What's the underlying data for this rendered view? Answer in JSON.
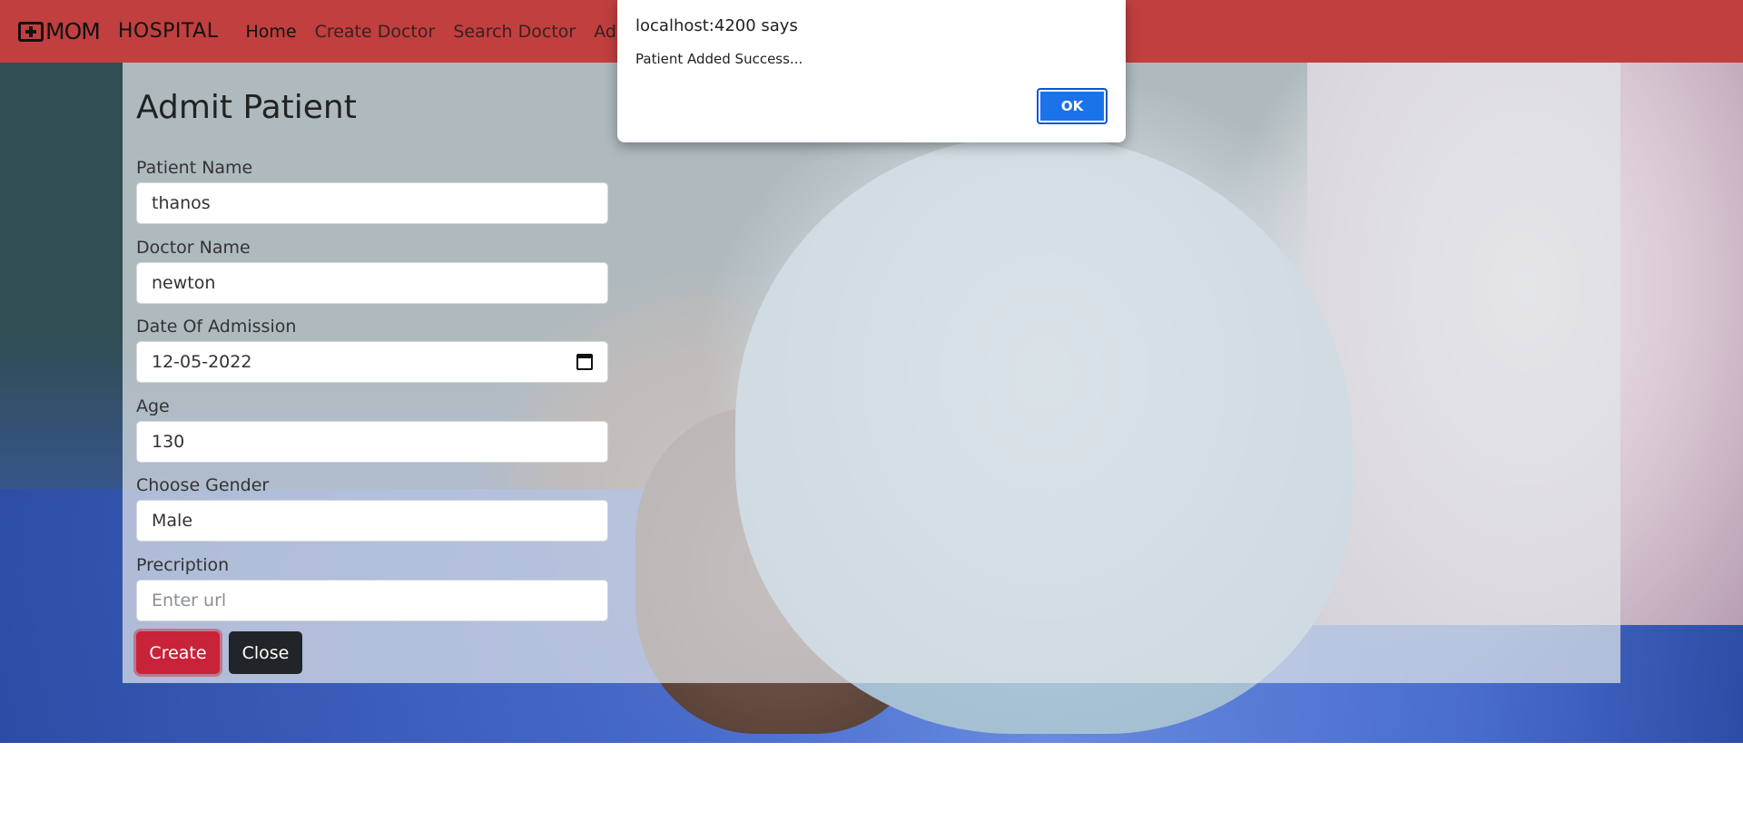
{
  "navbar": {
    "logo_text": "MOM",
    "brand": "HOSPITAL",
    "links": [
      "Home",
      "Create Doctor",
      "Search Doctor",
      "Adm"
    ],
    "active_link": "Home",
    "background_color": "#c13f3f"
  },
  "form": {
    "title": "Admit Patient",
    "fields": {
      "patient_name": {
        "label": "Patient Name",
        "value": "thanos"
      },
      "doctor_name": {
        "label": "Doctor Name",
        "value": "newton"
      },
      "date_of_admission": {
        "label": "Date Of Admission",
        "value": "12-05-2022"
      },
      "age": {
        "label": "Age",
        "value": "130"
      },
      "gender": {
        "label": "Choose Gender",
        "value": "Male"
      },
      "prescription": {
        "label": "Precription",
        "placeholder": "Enter url",
        "value": ""
      }
    },
    "buttons": {
      "create": "Create",
      "close": "Close"
    }
  },
  "dialog": {
    "title": "localhost:4200 says",
    "message": "Patient Added Success...",
    "ok_label": "OK",
    "ok_color": "#1a73e8"
  }
}
